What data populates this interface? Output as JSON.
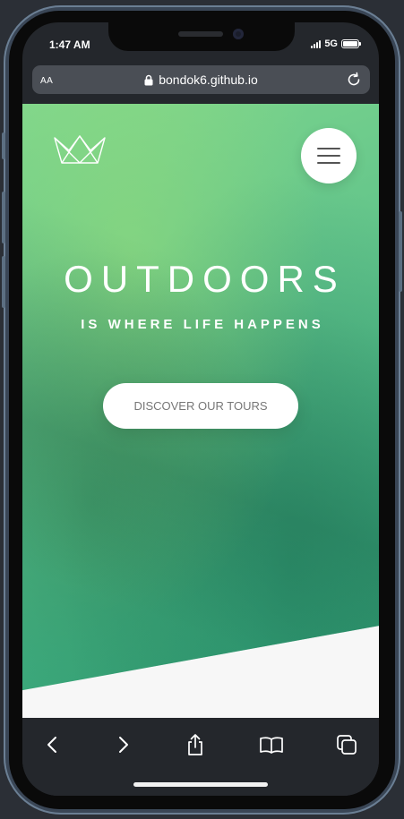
{
  "status_bar": {
    "time": "1:47 AM",
    "network": "5G",
    "icons": [
      "signal-bars-icon",
      "battery-icon"
    ]
  },
  "browser": {
    "text_size_label": "AA",
    "url": "bondok6.github.io",
    "icons": [
      "lock-icon",
      "reload-icon"
    ]
  },
  "page": {
    "logo_icon": "crown-logo-icon",
    "menu_icon": "hamburger-menu-icon",
    "heading": "OUTDOORS",
    "subheading": "IS WHERE LIFE HAPPENS",
    "cta_label": "DISCOVER OUR TOURS",
    "colors": {
      "hero_light": "#7ed68e",
      "hero_dark": "#2f9c73",
      "text": "#ffffff",
      "button_bg": "#ffffff",
      "button_text": "#777777"
    }
  },
  "toolbar": {
    "icons": [
      "back-icon",
      "forward-icon",
      "share-icon",
      "bookmarks-icon",
      "tabs-icon"
    ]
  }
}
